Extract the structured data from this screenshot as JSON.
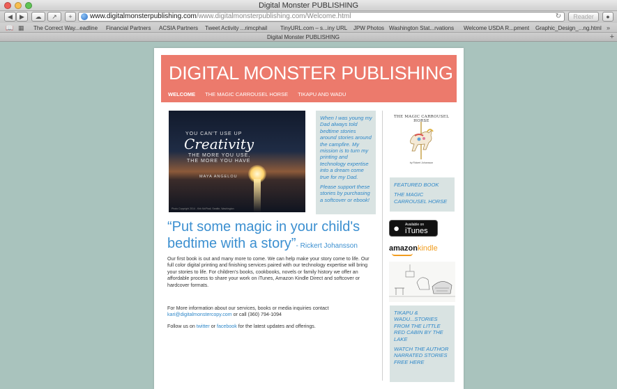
{
  "window": {
    "title": "Digital Monster PUBLISHING",
    "traffic_colors": [
      "#ee5f58",
      "#f7be4f",
      "#5fc454"
    ]
  },
  "toolbar": {
    "back_icon": "chevron-left-icon",
    "forward_icon": "chevron-right-icon",
    "cloud_icon": "icloud-tabs-icon",
    "share_icon": "share-icon",
    "new_tab_icon": "plus-icon",
    "url_host": "www.digitalmonsterpublishing.com",
    "url_rest": "/www.digitalmonsterpublishing.com/Welcome.html",
    "reload_icon": "reload-icon",
    "reader_label": "Reader",
    "downloads_icon": "downloads-icon"
  },
  "bookmarks": {
    "items": [
      "The Correct Way...eadline",
      "Financial Partners",
      "ACSIA Partners",
      "Tweet Activity ...rimcphail",
      "TinyURL.com – s...iny URL",
      "JPW Photos",
      "Washington Stat...rvations",
      "Welcome USDA R...pment",
      "Graphic_Design_...ng.html"
    ]
  },
  "tabbar": {
    "active_tab": "Digital Monster PUBLISHING",
    "plus_label": "+"
  },
  "site": {
    "title": "DIGITAL MONSTER PUBLISHING",
    "nav": [
      "WELCOME",
      "THE MAGIC CARROUSEL HORSE",
      "TIKAPU AND WADU"
    ]
  },
  "hero": {
    "line1": "YOU CAN'T USE UP",
    "creativity": "Creativity",
    "line3": "THE MORE YOU USE,",
    "line4": "THE MORE YOU HAVE",
    "author": "MAYA ANGELOU",
    "credit": "Photo Copyright 2014 - Kirk McPhail, Seattle, Washington"
  },
  "story_box": {
    "p1": "When I was young my Dad always told bedtime stories around stories around the campfire. My mission is to turn my printing and technology expertise into a dream come true for my Dad.",
    "p2": "Please support these stories by purchasing a softcover or ebook!"
  },
  "main": {
    "quote": "“Put some magic in your child's bedtime with a story”",
    "quote_dash": "- ",
    "quote_author": "Rickert Johansson",
    "body": "Our first book is out and many more to come.  We can help make your story come to life.  Our full color digital printing and finishing services paired with our technology expertise will bring your stories to life.  For children's books, cookbooks, novels or family history we offer an affordable process to share your work on iTunes, Amazon Kindle Direct and softcover or hardcover formats.",
    "contact_intro": "For More information about our services, books or media inquiries contact",
    "contact_email": "kari@digitalmonstercopy.com",
    "contact_phone": " or call (360) 794-1094",
    "follow_pre": "Follow us on ",
    "twitter": "twitter",
    "follow_or": " or ",
    "facebook": "facebook",
    "follow_post": " for the latest updates and offerings."
  },
  "sidebar": {
    "cover_title": "THE MAGIC CARROUSEL HORSE",
    "cover_author": "by Rickert Johansson",
    "featured_p1": "FEATURED BOOK",
    "featured_p2": "THE MAGIC CARROUSEL HORSE",
    "itunes_small": "Available on",
    "itunes_big": "iTunes",
    "amazon": "amazon",
    "kindle": "kindle",
    "tikapu_p1": "TIKAPU & WADU...STORIES FROM THE LITTLE RED CABIN BY THE LAKE",
    "tikapu_p2": "WATCH THE AUTHOR NARRATED STORIES FREE HERE"
  },
  "colors": {
    "banner": "#ec7a6c",
    "link_blue": "#2e87c8",
    "sidebar_box": "#d9e3e2",
    "desktop": "#a9c3bd"
  }
}
